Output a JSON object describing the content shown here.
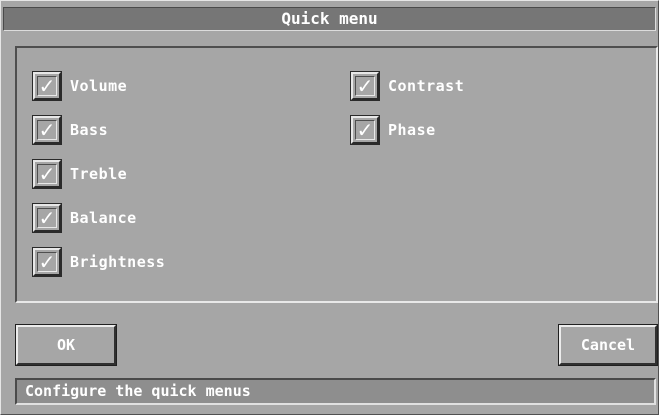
{
  "dialog": {
    "title": "Quick menu"
  },
  "options": [
    {
      "label": "Volume",
      "checked": true
    },
    {
      "label": "Bass",
      "checked": true
    },
    {
      "label": "Treble",
      "checked": true
    },
    {
      "label": "Balance",
      "checked": true
    },
    {
      "label": "Brightness",
      "checked": true
    },
    {
      "label": "Contrast",
      "checked": true
    },
    {
      "label": "Phase",
      "checked": true
    }
  ],
  "check_glyph": "✓",
  "buttons": {
    "ok_label": "OK",
    "cancel_label": "Cancel"
  },
  "status": {
    "text": "Configure the quick menus"
  },
  "colors": {
    "background": "#a6a6a6",
    "titlebar": "#767676",
    "status_bar": "#8e8e8e",
    "text": "#ffffff"
  }
}
